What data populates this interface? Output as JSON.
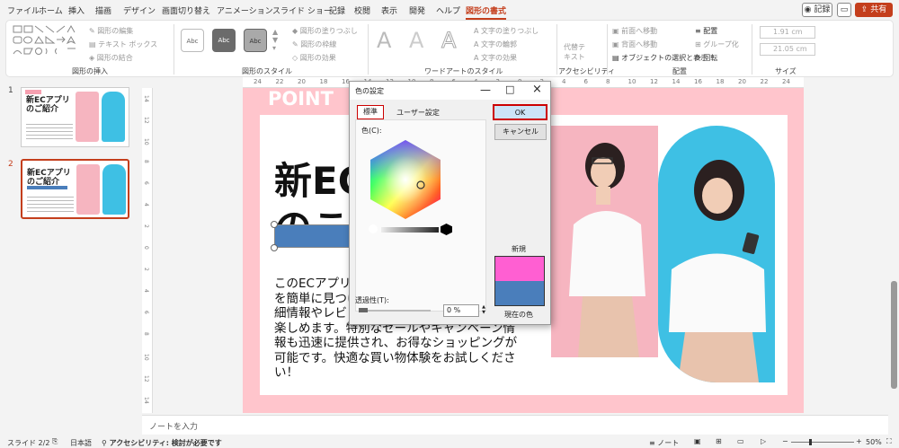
{
  "menu": [
    "ファイル",
    "ホーム",
    "挿入",
    "描画",
    "デザイン",
    "画面切り替え",
    "アニメーション",
    "スライド ショー",
    "記録",
    "校閲",
    "表示",
    "開発",
    "ヘルプ",
    "図形の書式"
  ],
  "topbar": {
    "record": "記録",
    "share": "共有"
  },
  "ribbon": {
    "groups": [
      "図形の挿入",
      "図形のスタイル",
      "ワードアートのスタイル",
      "アクセシビリティ",
      "配置",
      "サイズ"
    ],
    "insert": [
      "図形の編集",
      "テキスト ボックス",
      "図形の結合"
    ],
    "styles": [
      "図形の塗りつぶし",
      "図形の枠線",
      "図形の効果"
    ],
    "style_box": "Abc",
    "wordart_letter": "A",
    "text": [
      "文字の塗りつぶし",
      "文字の輪郭",
      "文字の効果"
    ],
    "accessibility": "代替テキスト",
    "arrange": [
      "前面へ移動",
      "背面へ移動",
      "オブジェクトの選択と表示",
      "配置",
      "グループ化",
      "回転"
    ],
    "size": {
      "height": "1.91 cm",
      "width": "21.05 cm"
    }
  },
  "slides": [
    {
      "num": "1",
      "title": "新ECアプリのご紹介"
    },
    {
      "num": "2",
      "title": "新ECアプリのご紹介"
    }
  ],
  "ruler": {
    "h": [
      "24",
      "22",
      "20",
      "18",
      "16",
      "14",
      "12",
      "10",
      "8",
      "6",
      "4",
      "2",
      "0",
      "2",
      "4",
      "6",
      "8",
      "10",
      "12",
      "14",
      "16",
      "18",
      "20",
      "22",
      "24"
    ],
    "v": [
      "14",
      "12",
      "10",
      "8",
      "6",
      "4",
      "2",
      "0",
      "2",
      "4",
      "6",
      "8",
      "10",
      "12",
      "14"
    ]
  },
  "slide": {
    "point": "POINT",
    "title_l1": "新EC",
    "title_l2": "のこ",
    "body_lines": [
      "このECアプリ",
      "を簡単に見つけ",
      "細情報やレビュ",
      "楽しめます。特別なセールやキャンペーン情",
      "報も迅速に提供され、お得なショッピングが",
      "可能です。快適な買い物体験をお試しくださ",
      "い！"
    ]
  },
  "notes": "ノートを入力",
  "status": {
    "slide": "スライド 2/2",
    "lang": "日本語",
    "accessibility": "アクセシビリティ: 検討が必要です",
    "notes": "ノート",
    "zoom": "50%"
  },
  "dialog": {
    "title": "色の設定",
    "tab_standard": "標準",
    "tab_custom": "ユーザー設定",
    "colors_label": "色(C):",
    "ok": "OK",
    "cancel": "キャンセル",
    "new_label": "新規",
    "current_label": "現在の色",
    "transparency_label": "透過性(T):",
    "transparency_value": "0 %",
    "new_color": "#ff5fd2",
    "current_color": "#4a7ebb"
  },
  "colors": {
    "accent": "#c43e1c",
    "slide_bg": "#ffc5cc",
    "photo1_bg": "#f6b5c0",
    "photo2_bg": "#3ec0e4",
    "title_bar": "#4a7ebb"
  }
}
